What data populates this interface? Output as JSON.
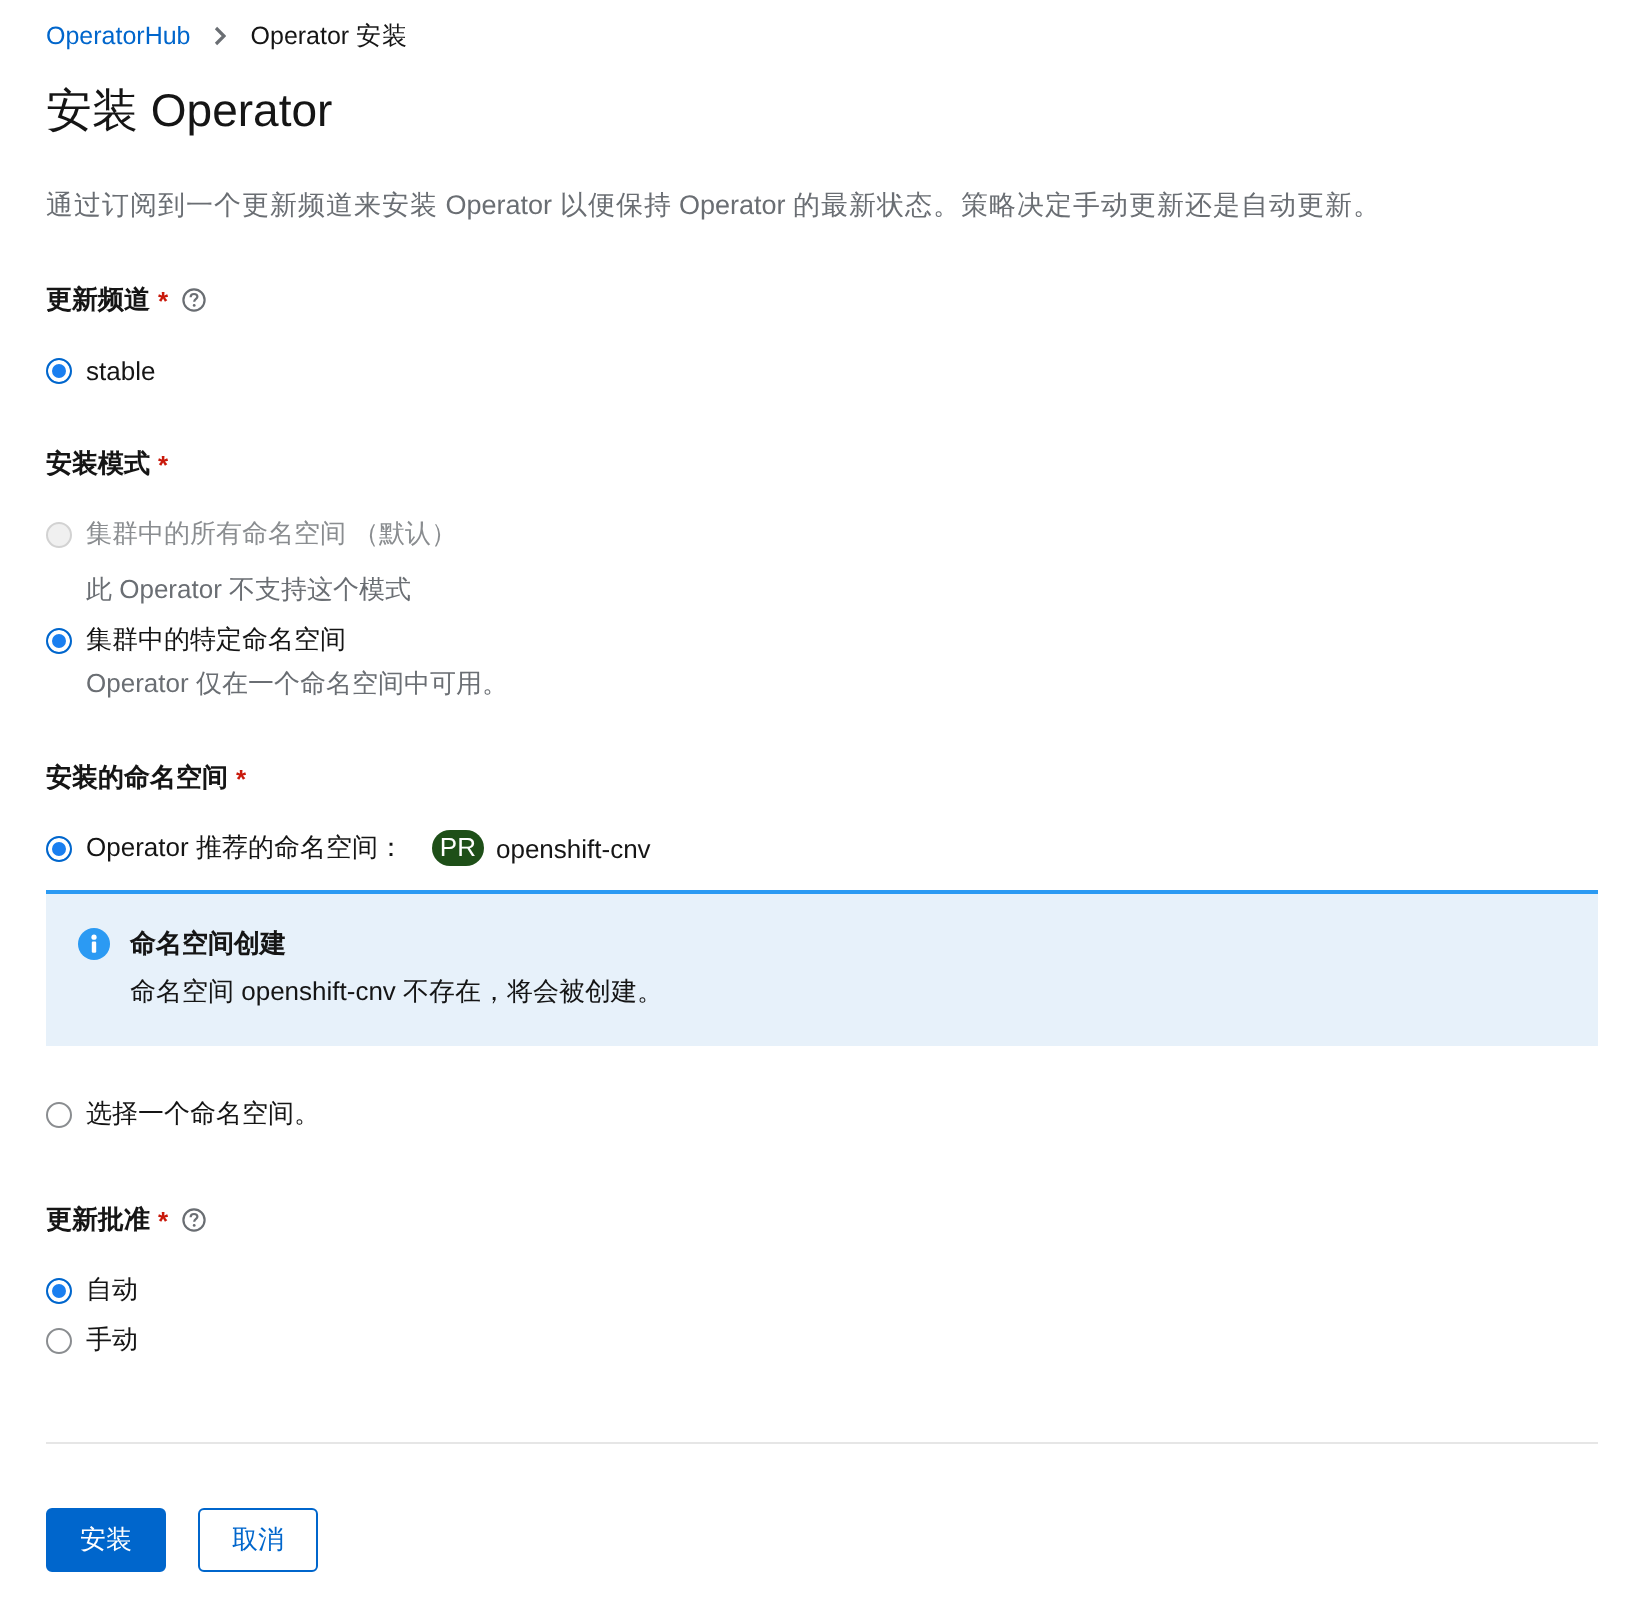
{
  "breadcrumb": [
    {
      "label": "OperatorHub",
      "kind": "link"
    },
    {
      "label": "Operator 安装",
      "kind": "current"
    }
  ],
  "title": "安装 Operator",
  "description": "通过订阅到一个更新频道来安装 Operator 以便保持 Operator 的最新状态。策略决定手动更新还是自动更新。",
  "sections": [
    {
      "label": "更新频道",
      "required_mark": "*",
      "help": true,
      "options": [
        {
          "label": "stable",
          "selected": true,
          "disabled": false
        }
      ]
    },
    {
      "label": "安装模式",
      "required_mark": "*",
      "help": false,
      "options": [
        {
          "label": "集群中的所有命名空间 （默认）",
          "selected": false,
          "disabled": true,
          "helper": "此 Operator 不支持这个模式"
        },
        {
          "label": "集群中的特定命名空间",
          "selected": true,
          "disabled": false,
          "helper": "Operator 仅在一个命名空间中可用。"
        }
      ]
    },
    {
      "label": "安装的命名空间",
      "required_mark": "*",
      "help": false,
      "options": [
        {
          "label": "Operator 推荐的命名空间：",
          "selected": true,
          "disabled": false,
          "badge": "PR",
          "namespace": "openshift-cnv",
          "alert": {
            "title": "命名空间创建",
            "text": "命名空间 openshift-cnv 不存在，将会被创建。"
          }
        },
        {
          "label": "选择一个命名空间。",
          "selected": false,
          "disabled": false
        }
      ]
    },
    {
      "label": "更新批准",
      "required_mark": "*",
      "help": true,
      "options": [
        {
          "label": "自动",
          "selected": true,
          "disabled": false
        },
        {
          "label": "手动",
          "selected": false,
          "disabled": false
        }
      ]
    }
  ],
  "buttons": [
    {
      "label": "安装",
      "kind": "primary"
    },
    {
      "label": "取消",
      "kind": "secondary"
    }
  ]
}
